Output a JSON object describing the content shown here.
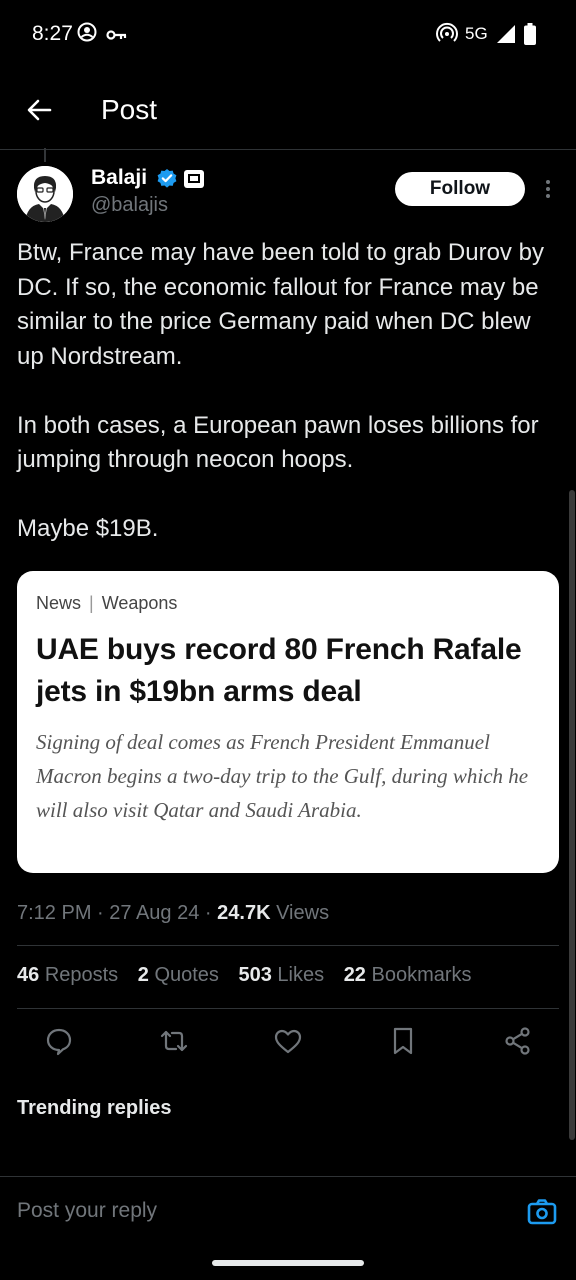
{
  "status_bar": {
    "time": "8:27",
    "network": "5G",
    "icons": [
      "account-circle-icon",
      "key-icon",
      "hotspot-icon",
      "signal-icon",
      "battery-icon"
    ]
  },
  "header": {
    "back_icon": "arrow-left-icon",
    "title": "Post"
  },
  "post": {
    "author": {
      "name": "Balaji",
      "handle": "@balajis",
      "verified": true,
      "verified_color": "#1d9bf0"
    },
    "follow_label": "Follow",
    "text": [
      "Btw, France may have been told to grab Durov by DC. If so, the economic fallout for France may be similar to the price Germany paid when DC blew up Nordstream.",
      "In both cases, a European pawn loses billions for jumping through neocon hoops.",
      "Maybe $19B."
    ],
    "card": {
      "kicker_section": "News",
      "kicker_topic": "Weapons",
      "title": "UAE buys record 80 French Rafale jets in $19bn arms deal",
      "dek": "Signing of deal comes as French President Emmanuel Macron begins a two-day trip to the Gulf, during which he will also visit Qatar and Saudi Arabia."
    },
    "meta": {
      "time": "7:12 PM",
      "date": "27 Aug 24",
      "views_count": "24.7K",
      "views_label": "Views"
    },
    "stats": {
      "reposts_count": "46",
      "reposts_label": "Reposts",
      "quotes_count": "2",
      "quotes_label": "Quotes",
      "likes_count": "503",
      "likes_label": "Likes",
      "bookmarks_count": "22",
      "bookmarks_label": "Bookmarks"
    },
    "actions": [
      "reply-icon",
      "repost-icon",
      "like-icon",
      "bookmark-icon",
      "share-icon"
    ]
  },
  "trending_replies": "Trending replies",
  "reply_bar": {
    "placeholder": "Post your reply",
    "camera_color": "#1d9bf0"
  },
  "colors": {
    "background": "#000000",
    "text": "#e7e9ea",
    "muted": "#71767b",
    "accent": "#1d9bf0"
  }
}
